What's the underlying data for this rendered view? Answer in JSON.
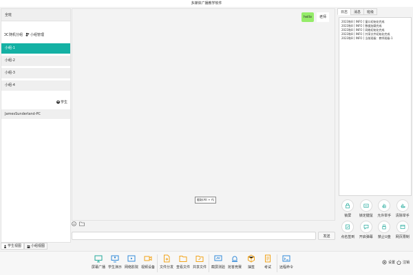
{
  "window": {
    "title": "多媒体广播教学软件"
  },
  "left_panel": {
    "header": "全班",
    "actions": {
      "random_group": "随机分组",
      "group_manage": "小组管理",
      "add_group": "小组"
    },
    "groups": [
      "小组-1",
      "小组-2",
      "小组-3",
      "小组-4"
    ],
    "active_group": "小组-1",
    "add_student": "学生",
    "pc_name": "JamesSunderland-PC"
  },
  "bottom_tabs": {
    "student_view": "学生视图",
    "group_view": "小组视图"
  },
  "chat": {
    "message": "hello",
    "sender": "老师",
    "tooltip": "截取(Alt + A)",
    "input_placeholder": "",
    "send_label": "发送"
  },
  "right_panel": {
    "tabs": [
      "日志",
      "消息",
      "班级"
    ],
    "active_tab": "日志",
    "logs": [
      "2023秋8 [ INFO ] 窗口初始化完成",
      "2023秋8 [ INFO ] 数据加载完成",
      "2023秋8 [ INFO ] 网络初始化完成",
      "2023秋8 [ INFO ] 共享文件初始化完成",
      "2023秋8 [ INFO ] 当前班级：教师班级-1"
    ],
    "controls": [
      "锁屏",
      "锁定键鼠",
      "允许举手",
      "清除举手",
      "点名签到",
      "开启弹幕",
      "禁止U盘",
      "网页限制"
    ]
  },
  "toolbar": {
    "items": [
      "屏幕广播",
      "学生演示",
      "网络影院",
      "视频设备",
      "文件分发",
      "查看文件",
      "共享文件",
      "截屏测验",
      "抢答竞赛",
      "抽签",
      "考试",
      "远程命令"
    ],
    "settings": "设置",
    "logout": "注销"
  },
  "colors": {
    "accent": "#14b1a4",
    "bubble": "#95ec69",
    "icon_blue": "#2f88d8",
    "icon_orange": "#f2a317",
    "icon_teal": "#1fa89a"
  }
}
